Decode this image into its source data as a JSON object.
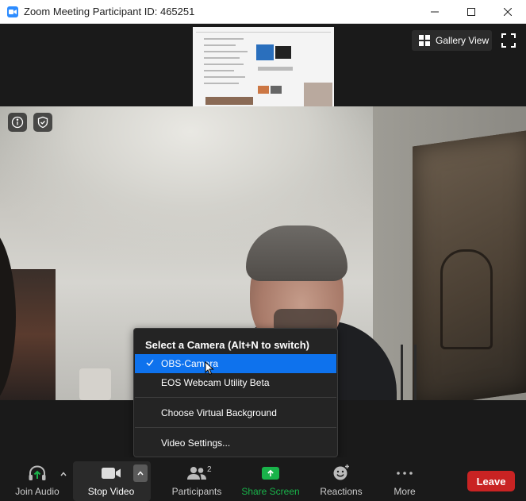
{
  "window": {
    "title": "Zoom Meeting Participant ID: 465251",
    "controls": [
      "minimize-icon",
      "maximize-icon",
      "close-icon"
    ]
  },
  "top_bar": {
    "view_button": "Gallery View",
    "view_icon": "gallery-grid-icon",
    "fullscreen_icon": "fullscreen-icon"
  },
  "video": {
    "info_icon": "info-icon",
    "security_icon": "shield-icon"
  },
  "camera_menu": {
    "title": "Select a Camera (Alt+N to switch)",
    "cameras": [
      {
        "label": "OBS-Camera",
        "selected": true
      },
      {
        "label": "EOS Webcam Utility Beta",
        "selected": false
      }
    ],
    "virtual_background": "Choose Virtual Background",
    "video_settings": "Video Settings..."
  },
  "toolbar": {
    "join_audio": "Join Audio",
    "stop_video": "Stop Video",
    "participants": "Participants",
    "participants_count": "2",
    "share_screen": "Share Screen",
    "reactions": "Reactions",
    "more": "More",
    "leave": "Leave"
  },
  "colors": {
    "accent": "#0e72ed",
    "share_green": "#19b34a",
    "leave_red": "#c92323",
    "zoom_blue": "#2d8cff"
  }
}
